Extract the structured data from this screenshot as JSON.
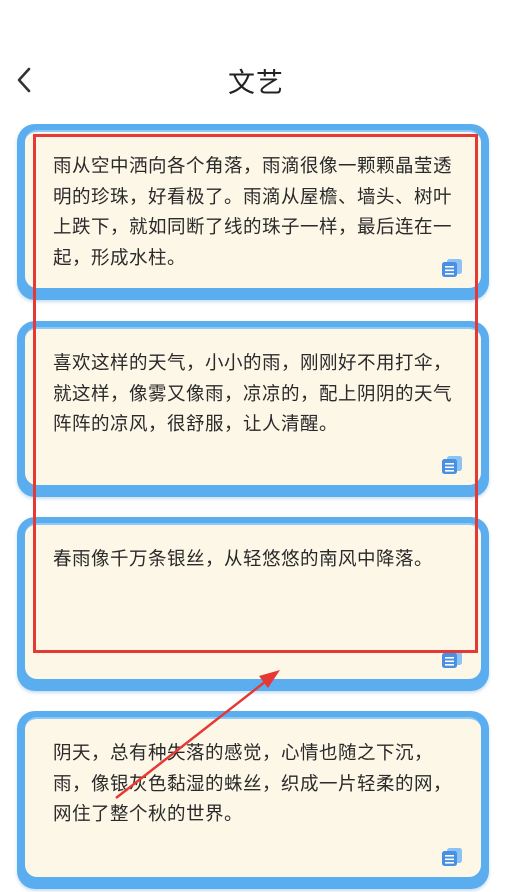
{
  "header": {
    "title": "文艺",
    "back_icon": "chevron-left-icon"
  },
  "cards": [
    {
      "text": "雨从空中洒向各个角落，雨滴很像一颗颗晶莹透明的珍珠，好看极了。雨滴从屋檐、墙头、树叶上跌下，就如同断了线的珠子一样，最后连在一起，形成水柱。",
      "icon": "copy-icon"
    },
    {
      "text": "喜欢这样的天气，小小的雨，刚刚好不用打伞，就这样，像雾又像雨，凉凉的，配上阴阴的天气阵阵的凉风，很舒服，让人清醒。",
      "icon": "copy-icon"
    },
    {
      "text": "春雨像千万条银丝，从轻悠悠的南风中降落。",
      "icon": "copy-icon"
    },
    {
      "text": "阴天，总有种失落的感觉，心情也随之下沉，雨，像银灰色黏湿的蛛丝，织成一片轻柔的网，网住了整个秋的世界。",
      "icon": "copy-icon"
    }
  ],
  "colors": {
    "card_border": "#5aaef0",
    "card_bg": "#fdf7e8",
    "annotation": "#e53935",
    "icon": "#4a90e2"
  }
}
